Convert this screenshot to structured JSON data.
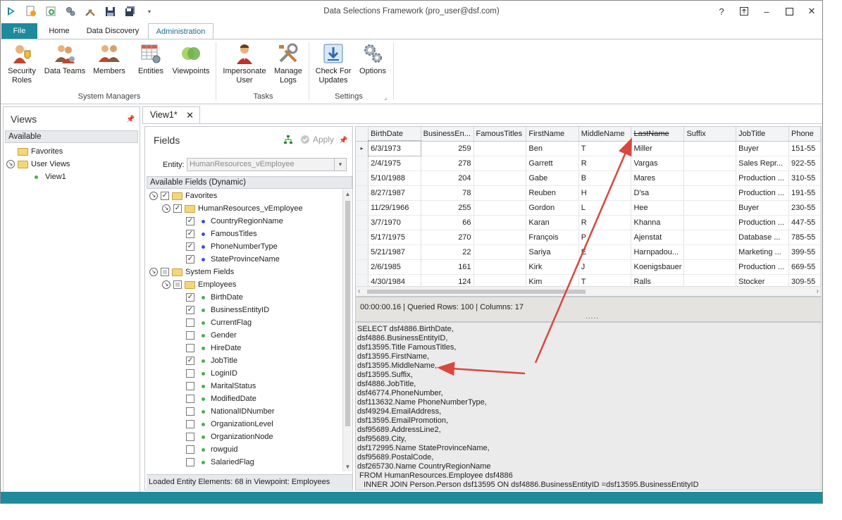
{
  "app": {
    "title": "Data Selections Framework (pro_user@dsf.com)"
  },
  "ribbon": {
    "tabs": [
      "File",
      "Home",
      "Data Discovery",
      "Administration"
    ],
    "buttons": {
      "security_roles": "Security\nRoles",
      "data_teams": "Data Teams",
      "members": "Members",
      "entities": "Entities",
      "viewpoints": "Viewpoints",
      "impersonate_user": "Impersonate\nUser",
      "manage_logs": "Manage\nLogs",
      "check_updates": "Check For\nUpdates",
      "options": "Options"
    },
    "groups": {
      "system_managers": "System Managers",
      "tasks": "Tasks",
      "settings": "Settings"
    }
  },
  "views": {
    "title": "Views",
    "available": "Available",
    "items": [
      "Favorites",
      "User Views",
      "View1"
    ]
  },
  "doc_tab": {
    "label": "View1*"
  },
  "fields": {
    "title": "Fields",
    "apply": "Apply",
    "entity_label": "Entity:",
    "entity_value": "HumanResources_vEmployee",
    "available_header": "Available Fields (Dynamic)",
    "favorites": "Favorites",
    "fav_entity": "HumanResources_vEmployee",
    "fav_fields": [
      "CountryRegionName",
      "FamousTitles",
      "PhoneNumberType",
      "StateProvinceName"
    ],
    "system_fields": "System Fields",
    "employees": "Employees",
    "employee_fields": [
      {
        "name": "BirthDate",
        "checked": true
      },
      {
        "name": "BusinessEntityID",
        "checked": true
      },
      {
        "name": "CurrentFlag",
        "checked": false
      },
      {
        "name": "Gender",
        "checked": false
      },
      {
        "name": "HireDate",
        "checked": false
      },
      {
        "name": "JobTitle",
        "checked": true
      },
      {
        "name": "LoginID",
        "checked": false
      },
      {
        "name": "MaritalStatus",
        "checked": false
      },
      {
        "name": "ModifiedDate",
        "checked": false
      },
      {
        "name": "NationalIDNumber",
        "checked": false
      },
      {
        "name": "OrganizationLevel",
        "checked": false
      },
      {
        "name": "OrganizationNode",
        "checked": false
      },
      {
        "name": "rowguid",
        "checked": false
      },
      {
        "name": "SalariedFlag",
        "checked": false
      }
    ],
    "status": "Loaded Entity Elements: 68 in Viewpoint: Employees"
  },
  "grid": {
    "columns": [
      "BirthDate",
      "BusinessEn...",
      "FamousTitles",
      "FirstName",
      "MiddleName",
      "LastName",
      "Suffix",
      "JobTitle",
      "Phone"
    ],
    "rows": [
      [
        "6/3/1973",
        "259",
        "",
        "Ben",
        "T",
        "Miller",
        "",
        "Buyer",
        "151-55"
      ],
      [
        "2/4/1975",
        "278",
        "",
        "Garrett",
        "R",
        "Vargas",
        "",
        "Sales Repr...",
        "922-55"
      ],
      [
        "5/10/1988",
        "204",
        "",
        "Gabe",
        "B",
        "Mares",
        "",
        "Production ...",
        "310-55"
      ],
      [
        "8/27/1987",
        "78",
        "",
        "Reuben",
        "H",
        "D'sa",
        "",
        "Production ...",
        "191-55"
      ],
      [
        "11/29/1966",
        "255",
        "",
        "Gordon",
        "L",
        "Hee",
        "",
        "Buyer",
        "230-55"
      ],
      [
        "3/7/1970",
        "66",
        "",
        "Karan",
        "R",
        "Khanna",
        "",
        "Production ...",
        "447-55"
      ],
      [
        "5/17/1975",
        "270",
        "",
        "François",
        "P",
        "Ajenstat",
        "",
        "Database ...",
        "785-55"
      ],
      [
        "5/21/1987",
        "22",
        "",
        "Sariya",
        "E",
        "Harnpadou...",
        "",
        "Marketing ...",
        "399-55"
      ],
      [
        "2/6/1985",
        "161",
        "",
        "Kirk",
        "J",
        "Koenigsbauer",
        "",
        "Production ...",
        "669-55"
      ],
      [
        "4/30/1984",
        "124",
        "",
        "Kim",
        "T",
        "Ralls",
        "",
        "Stocker",
        "309-55"
      ]
    ],
    "status": "00:00:00.16 | Queried Rows: 100 | Columns: 17",
    "splitter": "....."
  },
  "sql": {
    "lines": [
      "SELECT dsf4886.BirthDate,",
      "dsf4886.BusinessEntityID,",
      "dsf13595.Title FamousTitles,",
      "dsf13595.FirstName,",
      "dsf13595.MiddleName,",
      "dsf13595.Suffix,",
      "dsf4886.JobTitle,",
      "dsf46774.PhoneNumber,",
      "dsf113632.Name PhoneNumberType,",
      "dsf49294.EmailAddress,",
      "dsf13595.EmailPromotion,",
      "dsf95689.AddressLine2,",
      "dsf95689.City,",
      "dsf172995.Name StateProvinceName,",
      "dsf95689.PostalCode,",
      "dsf265730.Name CountryRegionName",
      " FROM HumanResources.Employee dsf4886",
      "   INNER JOIN Person.Person dsf13595 ON dsf4886.BusinessEntityID =dsf13595.BusinessEntityID"
    ]
  },
  "colors": {
    "accent": "#1e8a9c",
    "arrow": "#d9473f"
  }
}
